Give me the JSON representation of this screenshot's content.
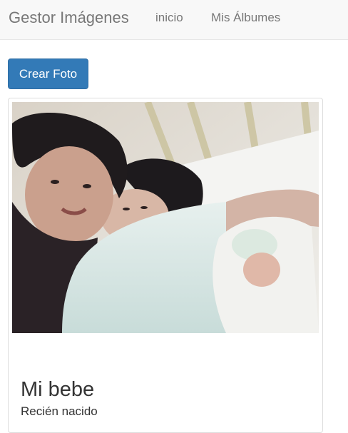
{
  "navbar": {
    "brand": "Gestor Imágenes",
    "links": [
      {
        "label": "inicio"
      },
      {
        "label": "Mis Álbumes"
      }
    ]
  },
  "actions": {
    "create_photo_label": "Crear Foto"
  },
  "photo_card": {
    "image_subject": "photo-family-newborn",
    "title": "Mi bebe",
    "description": "Recién nacido"
  },
  "colors": {
    "navbar_bg": "#f8f8f8",
    "primary_button": "#337ab7",
    "text": "#333333",
    "muted_text": "#777777"
  }
}
